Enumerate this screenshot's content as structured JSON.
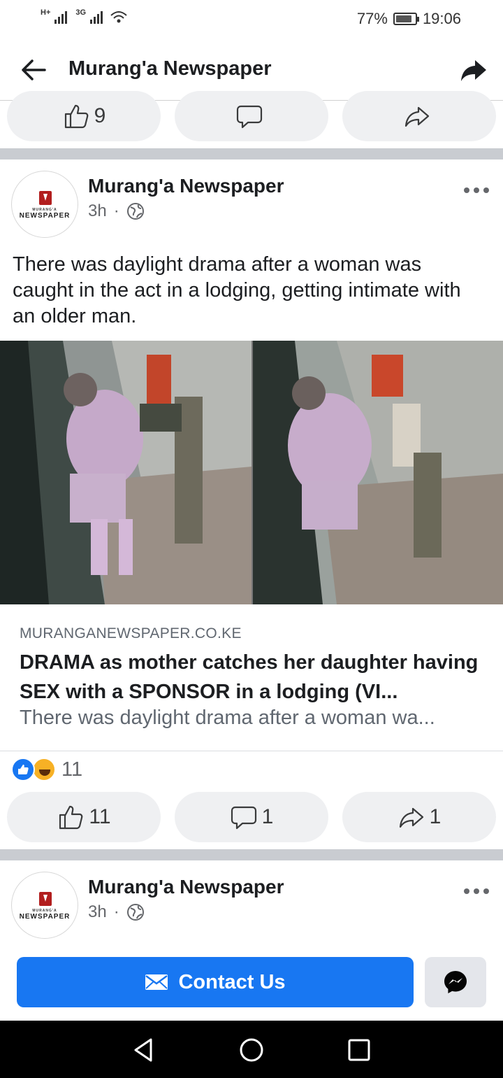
{
  "status_bar": {
    "net1": "H+",
    "net2": "3G",
    "battery_percent": "77%",
    "time": "19:06"
  },
  "header": {
    "title": "Murang'a Newspaper",
    "back_icon": "arrow-left-icon",
    "share_icon": "share-arrow-icon"
  },
  "top_actions": {
    "like_count": "9",
    "comment_count": "",
    "share_count": ""
  },
  "post1": {
    "avatar": {
      "logo_small": "MURANG'A",
      "logo_text": "NEWSPAPER"
    },
    "author": "Murang'a Newspaper",
    "time": "3h",
    "dot": "·",
    "text": "There was daylight drama after a woman was caught in the act in a lodging, getting intimate with an older man.",
    "link": {
      "domain": "MURANGANEWSPAPER.CO.KE",
      "title": "DRAMA as mother catches her daughter having SEX with a SPONSOR in a lodging (VI...",
      "description": "There was daylight drama after a woman wa..."
    },
    "reaction_count": "11",
    "actions": {
      "like_count": "11",
      "comment_count": "1",
      "share_count": "1"
    }
  },
  "post2": {
    "author": "Murang'a Newspaper",
    "time": "3h",
    "dot": "·"
  },
  "bottom": {
    "contact_label": "Contact Us"
  },
  "colors": {
    "accent": "#1877f2",
    "pill_bg": "#eff0f2",
    "divider": "#c9ccd1"
  }
}
